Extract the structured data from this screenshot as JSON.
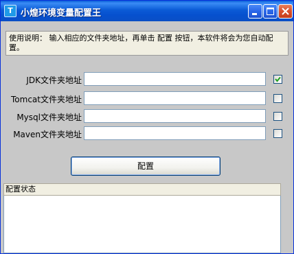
{
  "window": {
    "title": "小煌环境变量配置王",
    "icon_letter": "T",
    "icon": "app-icon",
    "controls": [
      "minimize-icon",
      "maximize-icon",
      "close-icon"
    ]
  },
  "instructions": {
    "text": "使用说明： 输入相应的文件夹地址，再单击 配置 按钮，本软件将会为您自动配置。"
  },
  "fields": [
    {
      "label": "JDK文件夹地址",
      "value": "",
      "checked": true
    },
    {
      "label": "Tomcat文件夹地址",
      "value": "",
      "checked": false
    },
    {
      "label": "Mysql文件夹地址",
      "value": "",
      "checked": false
    },
    {
      "label": "Maven文件夹地址",
      "value": "",
      "checked": false
    }
  ],
  "config_button": {
    "label": "配置"
  },
  "status": {
    "header": "配置状态",
    "content": ""
  },
  "colors": {
    "titlebar": "#0a5fd8",
    "client_bg": "#c8c8c8",
    "instruction_bg": "#f1efe2",
    "checkmark": "#21a121"
  }
}
